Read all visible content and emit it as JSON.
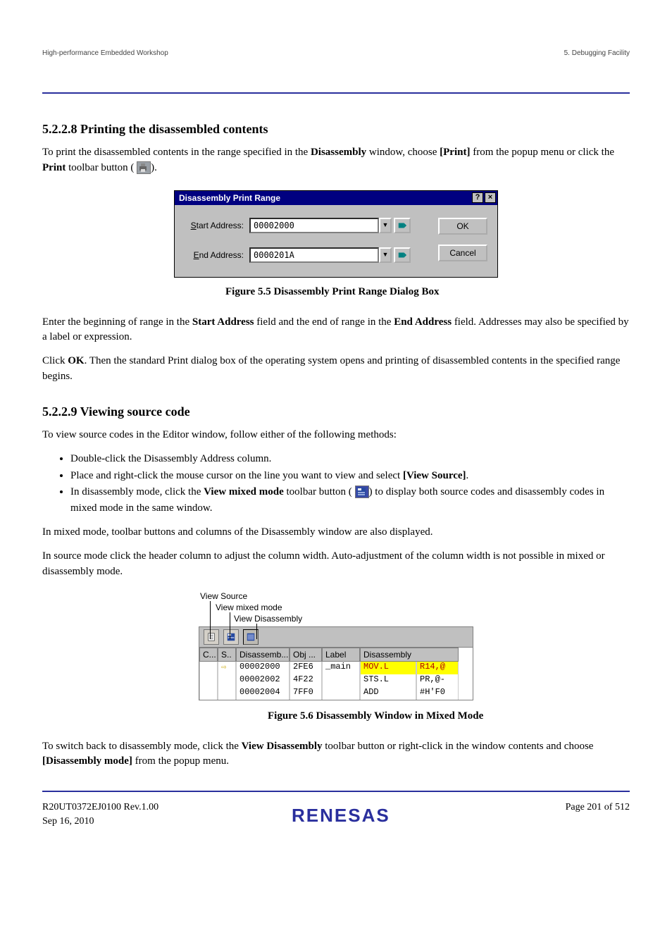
{
  "header": {
    "doc_title": "High-performance Embedded Workshop",
    "section_path": "5. Debugging Facility"
  },
  "s1": {
    "heading": "5.2.2.8 Printing the disassembled contents",
    "p1_a": "To print the disassembled contents in the range specified in the ",
    "p1_b": "Disassembly",
    "p1_c": " window, choose ",
    "p1_d": "[Print]",
    "p1_e": " from the popup menu or click the ",
    "p1_f": "Print",
    "p1_g": " toolbar button (",
    "p1_h": ")."
  },
  "dlg": {
    "title": "Disassembly Print Range",
    "start_label": "Start Address:",
    "start_value": "00002000",
    "end_label": "End Address:",
    "end_value": "0000201A",
    "ok": "OK",
    "cancel": "Cancel"
  },
  "figcap1": "Figure 5.5  Disassembly Print Range Dialog Box",
  "s1b": {
    "p2_a": "Enter the beginning of range in the ",
    "p2_b": "Start Address",
    "p2_c": " field and the end of range in the ",
    "p2_d": "End Address",
    "p2_e": " field. Addresses may also be specified by a label or expression.",
    "p3_a": "Click ",
    "p3_b": "OK",
    "p3_c": ". Then the standard Print dialog box of the operating system opens and printing of disassembled contents in the specified range begins."
  },
  "s2": {
    "heading": "5.2.2.9 Viewing source code",
    "intro": "To view source codes in the Editor window, follow either of the following methods:",
    "li1": "Double-click the Disassembly Address column.",
    "li2_a": "Place and right-click the mouse cursor on the line you want to view and select ",
    "li2_b": "[View Source]",
    "li2_c": ".",
    "li3_a": "In disassembly mode, click the ",
    "li3_b": "View mixed mode",
    "li3_c": " toolbar button (",
    "li3_d": ") to display both source codes and disassembly codes in mixed mode in the same window.",
    "p4": "In mixed mode, toolbar buttons and columns of the Disassembly window are also displayed.",
    "p5": "In source mode click the header column to adjust the column width. Auto-adjustment of the column width is not possible in mixed or disassembly mode."
  },
  "mix": {
    "l1": "View Source",
    "l2": "View mixed mode",
    "l3": "View Disassembly",
    "col1": "C...",
    "col2": "S..",
    "col3": "Disassemb...",
    "col4": "Obj ...",
    "col5": "Label",
    "col6": "Disassembly",
    "rows": [
      {
        "arrow": "⇨",
        "addr": "00002000",
        "obj": "2FE6",
        "label": "_main",
        "mn": "MOV.L",
        "op": "R14,@"
      },
      {
        "arrow": "",
        "addr": "00002002",
        "obj": "4F22",
        "label": "",
        "mn": "STS.L",
        "op": "PR,@-"
      },
      {
        "arrow": "",
        "addr": "00002004",
        "obj": "7FF0",
        "label": "",
        "mn": "ADD",
        "op": "#H'F0"
      }
    ]
  },
  "figcap2": "Figure 5.6  Disassembly Window in Mixed Mode",
  "s3": {
    "p6_a": "To switch back to disassembly mode, click the ",
    "p6_b": "View Disassembly",
    "p6_c": " toolbar button or right-click in the window contents and choose ",
    "p6_d": "[Disassembly mode]",
    "p6_e": " from the popup menu."
  },
  "page_ref": "R20UT0372EJ0100  Rev.1.00",
  "page_date": "Sep 16, 2010",
  "page_num": "Page 201 of 512"
}
